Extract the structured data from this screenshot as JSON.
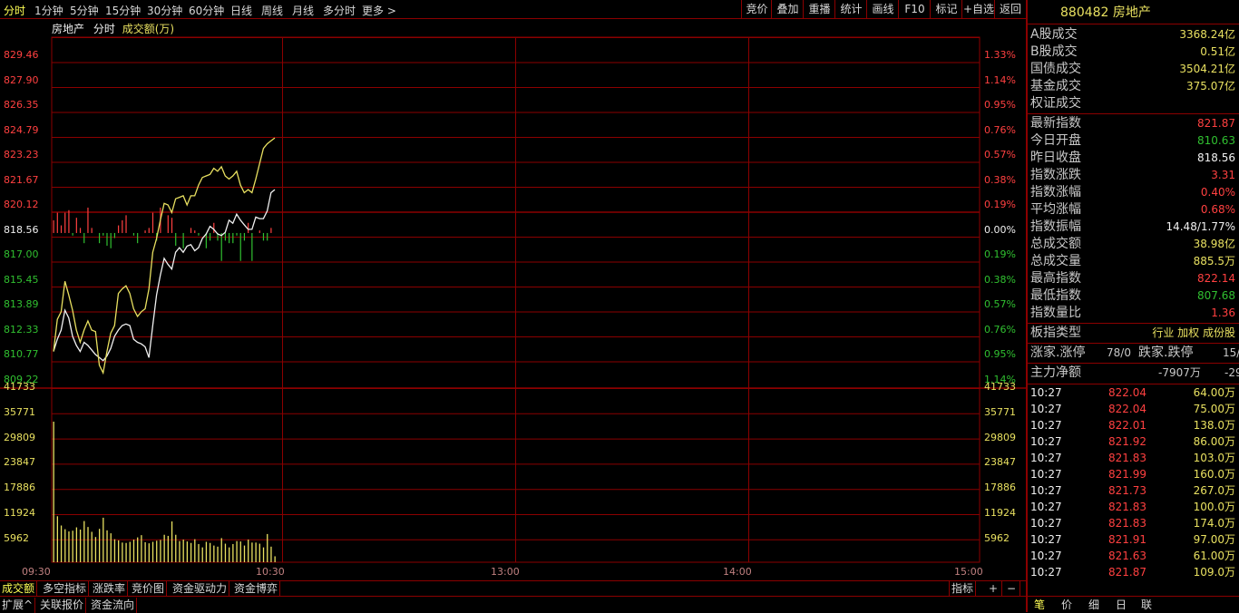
{
  "toolbar": {
    "left_items": [
      "分时",
      "1分钟",
      "5分钟",
      "15分钟",
      "30分钟",
      "60分钟",
      "日线",
      "周线",
      "月线",
      "多分时",
      "更多 >"
    ],
    "right_items": [
      "竞价",
      "叠加",
      "重播",
      "统计",
      "画线",
      "F10",
      "标记",
      "+自选",
      "返回"
    ]
  },
  "chart_header": {
    "name": "房地产",
    "mode": "分时",
    "indicator": "成交额(万)"
  },
  "chart_data": {
    "type": "line",
    "price_ticks_left": [
      "829.46",
      "827.90",
      "826.35",
      "824.79",
      "823.23",
      "821.67",
      "820.12",
      "818.56",
      "817.00",
      "815.45",
      "813.89",
      "812.33",
      "810.77",
      "809.22"
    ],
    "pct_ticks_right": [
      "1.33%",
      "1.14%",
      "0.95%",
      "0.76%",
      "0.57%",
      "0.38%",
      "0.19%",
      "0.00%",
      "0.19%",
      "0.38%",
      "0.57%",
      "0.76%",
      "0.95%",
      "1.14%"
    ],
    "volume_ticks_left": [
      "41733",
      "35771",
      "29809",
      "23847",
      "17886",
      "11924",
      "5962"
    ],
    "volume_ticks_right": [
      "41733",
      "35771",
      "29809",
      "23847",
      "17886",
      "11924",
      "5962"
    ],
    "time_ticks": [
      "09:30",
      "10:30",
      "13:00",
      "14:00",
      "15:00"
    ],
    "base_price": 818.56,
    "price_range": [
      808.4,
      830.2
    ],
    "volume_range": [
      0,
      44500
    ],
    "series": [
      {
        "color": "#f0f0f0",
        "values": [
          810.8,
          811.6,
          812.2,
          813.5,
          813.0,
          811.8,
          811.2,
          810.8,
          811.4,
          811.2,
          810.9,
          810.6,
          810.4,
          810.2,
          810.5,
          811.0,
          811.8,
          812.2,
          812.5,
          812.6,
          812.5,
          811.6,
          811.4,
          811.3,
          811.1,
          810.4,
          812.5,
          814.5,
          815.8,
          816.9,
          816.5,
          816.2,
          817.3,
          817.6,
          817.3,
          817.7,
          817.8,
          817.4,
          817.6,
          818.2,
          818.5,
          819.0,
          818.8,
          818.5,
          818.4,
          818.6,
          819.4,
          819.2,
          819.8,
          819.4,
          819.1,
          818.8,
          818.8,
          819.6,
          819.5,
          819.5,
          820.0,
          821.2,
          821.4
        ]
      },
      {
        "color": "#e8e060",
        "values": [
          810.8,
          812.9,
          813.4,
          815.4,
          814.5,
          813.5,
          812.2,
          811.4,
          812.2,
          812.8,
          812.2,
          812.1,
          809.9,
          809.4,
          810.8,
          812.0,
          812.5,
          814.6,
          814.9,
          815.1,
          814.6,
          813.6,
          813.1,
          813.4,
          813.6,
          814.9,
          817.3,
          818.2,
          819.4,
          820.5,
          820.4,
          819.9,
          820.8,
          820.9,
          821.0,
          820.4,
          821.0,
          821.0,
          821.7,
          822.2,
          822.3,
          822.4,
          822.8,
          822.6,
          822.9,
          822.3,
          822.1,
          822.3,
          822.6,
          821.7,
          821.2,
          821.4,
          821.2,
          822.1,
          823.1,
          824.1,
          824.4,
          824.6,
          824.79
        ]
      }
    ],
    "volume": [
      37900,
      12400,
      9900,
      8900,
      8300,
      8500,
      9400,
      8800,
      11100,
      9500,
      8200,
      6800,
      9000,
      12000,
      8600,
      7800,
      6200,
      5900,
      5300,
      5200,
      5500,
      6100,
      6700,
      7300,
      5400,
      5100,
      5500,
      5800,
      6000,
      7400,
      7100,
      11000,
      7400,
      5700,
      6100,
      5600,
      5200,
      6200,
      4900,
      4000,
      5500,
      5200,
      4500,
      4200,
      6500,
      5000,
      4000,
      4900,
      5700,
      5600,
      4500,
      6100,
      5300,
      5300,
      5000,
      4000,
      7600,
      4200,
      1600
    ],
    "net_bars": [
      5,
      8,
      3,
      8,
      9,
      -1,
      6,
      2,
      -4,
      10,
      2,
      0,
      -4,
      -1,
      -5,
      -6,
      -2,
      3,
      5,
      7,
      0,
      -1,
      -4,
      0,
      1,
      2,
      8,
      -3,
      10,
      0,
      7,
      6,
      -5,
      0,
      -6,
      0,
      2,
      1,
      -1,
      0,
      -6,
      -3,
      4,
      -3,
      -11,
      -3,
      -4,
      -4,
      -1,
      -11,
      -3,
      4,
      -11,
      0,
      1,
      -3,
      -3,
      2,
      0
    ]
  },
  "bottom_tabs": [
    "成交额",
    "多空指标",
    "涨跌率",
    "竞价图",
    "资金驱动力",
    "资金博弈"
  ],
  "bottom_tabs_right": [
    "指标",
    "+",
    "−"
  ],
  "bottom_bar": [
    "扩展^",
    "关联报价",
    "资金流向"
  ],
  "right_panel": {
    "code": "880482",
    "name": "房地产",
    "market_rows": [
      {
        "label": "A股成交",
        "value": "3368.24亿"
      },
      {
        "label": "B股成交",
        "value": "0.51亿"
      },
      {
        "label": "国债成交",
        "value": "3504.21亿"
      },
      {
        "label": "基金成交",
        "value": "375.07亿"
      },
      {
        "label": "权证成交",
        "value": ""
      }
    ],
    "index_rows": [
      {
        "label": "最新指数",
        "value": "821.87",
        "color": "#ff4040"
      },
      {
        "label": "今日开盘",
        "value": "810.63",
        "color": "#30c030"
      },
      {
        "label": "昨日收盘",
        "value": "818.56",
        "color": "#f0f0f0"
      },
      {
        "label": "指数涨跌",
        "value": "3.31",
        "color": "#ff4040"
      },
      {
        "label": "指数涨幅",
        "value": "0.40%",
        "color": "#ff4040"
      },
      {
        "label": "平均涨幅",
        "value": "0.68%",
        "color": "#ff4040"
      },
      {
        "label": "指数振幅",
        "value": "14.48/1.77%",
        "color": "#f0f0f0"
      },
      {
        "label": "总成交额",
        "value": "38.98亿",
        "color": "#e8e060"
      },
      {
        "label": "总成交量",
        "value": "885.5万",
        "color": "#e8e060"
      },
      {
        "label": "最高指数",
        "value": "822.14",
        "color": "#ff4040"
      },
      {
        "label": "最低指数",
        "value": "807.68",
        "color": "#30c030"
      },
      {
        "label": "指数量比",
        "value": "1.36",
        "color": "#ff4040"
      }
    ],
    "type_row": {
      "label": "板指类型",
      "value": "行业 加权 成份股"
    },
    "updown_row": {
      "label1": "涨家.涨停",
      "value1": "78/0",
      "label2": "跌家.跌停",
      "value2": "15/"
    },
    "netflow_row": {
      "label": "主力净额",
      "value1": "-7907万",
      "value2": "-29"
    },
    "ticks": [
      {
        "time": "10:27",
        "price": "822.04",
        "amount": "64.00万"
      },
      {
        "time": "10:27",
        "price": "822.04",
        "amount": "75.00万"
      },
      {
        "time": "10:27",
        "price": "822.01",
        "amount": "138.0万"
      },
      {
        "time": "10:27",
        "price": "821.92",
        "amount": "86.00万"
      },
      {
        "time": "10:27",
        "price": "821.83",
        "amount": "103.0万"
      },
      {
        "time": "10:27",
        "price": "821.99",
        "amount": "160.0万"
      },
      {
        "time": "10:27",
        "price": "821.73",
        "amount": "267.0万"
      },
      {
        "time": "10:27",
        "price": "821.83",
        "amount": "100.0万"
      },
      {
        "time": "10:27",
        "price": "821.83",
        "amount": "174.0万"
      },
      {
        "time": "10:27",
        "price": "821.91",
        "amount": "97.00万"
      },
      {
        "time": "10:27",
        "price": "821.63",
        "amount": "61.00万"
      },
      {
        "time": "10:27",
        "price": "821.87",
        "amount": "109.0万"
      }
    ],
    "footer_tabs": [
      "笔",
      "价",
      "细",
      "日",
      "联"
    ]
  },
  "colors": {
    "up": "#ff4040",
    "down": "#30c030",
    "grid": "#8b0000",
    "avg": "#e8e060",
    "price": "#f0f0f0",
    "background": "#000000"
  }
}
